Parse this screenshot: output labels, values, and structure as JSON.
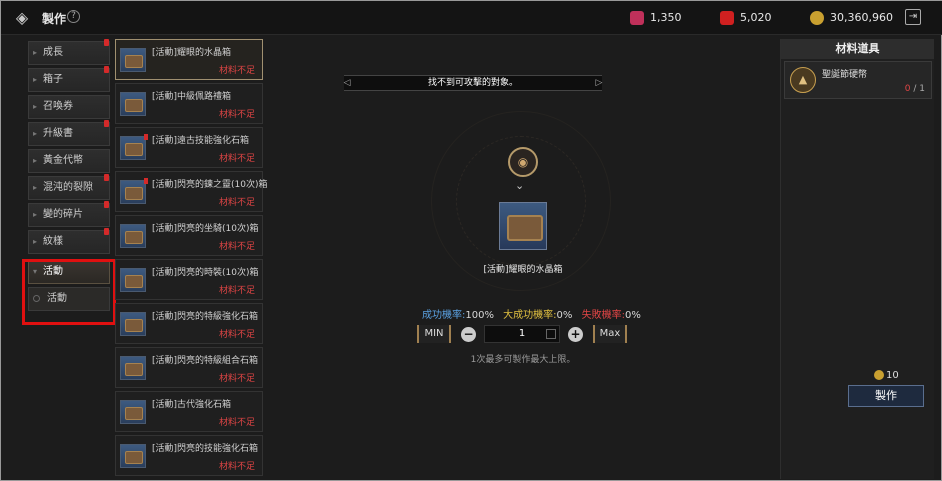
{
  "header": {
    "title": "製作",
    "help_icon": "?",
    "currencies": [
      {
        "name": "crystal",
        "value": "1,350",
        "color": "#c0305a"
      },
      {
        "name": "red-gem",
        "value": "5,020",
        "color": "#d02020"
      },
      {
        "name": "gold",
        "value": "30,360,960",
        "color": "#c9a030"
      }
    ]
  },
  "categories": [
    {
      "label": "成長",
      "badge": true
    },
    {
      "label": "箱子",
      "badge": true
    },
    {
      "label": "召喚券",
      "badge": false
    },
    {
      "label": "升級書",
      "badge": true
    },
    {
      "label": "黃金代幣",
      "badge": false
    },
    {
      "label": "混沌的裂隙",
      "badge": true
    },
    {
      "label": "變的碎片",
      "badge": true
    },
    {
      "label": "紋樣",
      "badge": true
    },
    {
      "label": "活動",
      "badge": false
    },
    {
      "label": "活動",
      "badge": false
    }
  ],
  "items": [
    {
      "name": "[活動]耀眼的水晶箱",
      "status": "材料不足"
    },
    {
      "name": "[活動]中級佩路禮箱",
      "status": "材料不足"
    },
    {
      "name": "[活動]遠古技能強化石箱",
      "status": "材料不足"
    },
    {
      "name": "[活動]閃亮的鍊之靈(10次)箱",
      "status": "材料不足"
    },
    {
      "name": "[活動]閃亮的坐騎(10次)箱",
      "status": "材料不足"
    },
    {
      "name": "[活動]閃亮的時裝(10次)箱",
      "status": "材料不足"
    },
    {
      "name": "[活動]閃亮的特級強化石箱",
      "status": "材料不足"
    },
    {
      "name": "[活動]閃亮的特級組合石箱",
      "status": "材料不足"
    },
    {
      "name": "[活動]古代強化石箱",
      "status": "材料不足"
    },
    {
      "name": "[活動]閃亮的技能強化石箱",
      "status": "材料不足"
    }
  ],
  "center": {
    "banner": "找不到可攻擊的對象。",
    "selected_item_name": "[活動]耀眼的水晶箱",
    "success_label": "成功機率:",
    "success_value": "100%",
    "great_label": "大成功機率:",
    "great_value": "0%",
    "fail_label": "失敗機率:",
    "fail_value": "0%",
    "min_label": "MIN",
    "max_label": "Max",
    "quantity": "1",
    "hint": "1次最多可製作最大上限。"
  },
  "materials": {
    "header": "材料道具",
    "items": [
      {
        "name": "聖誕節硬幣",
        "have": "0",
        "need": "/ 1"
      }
    ]
  },
  "craft": {
    "cost": "10",
    "button_label": "製作"
  }
}
